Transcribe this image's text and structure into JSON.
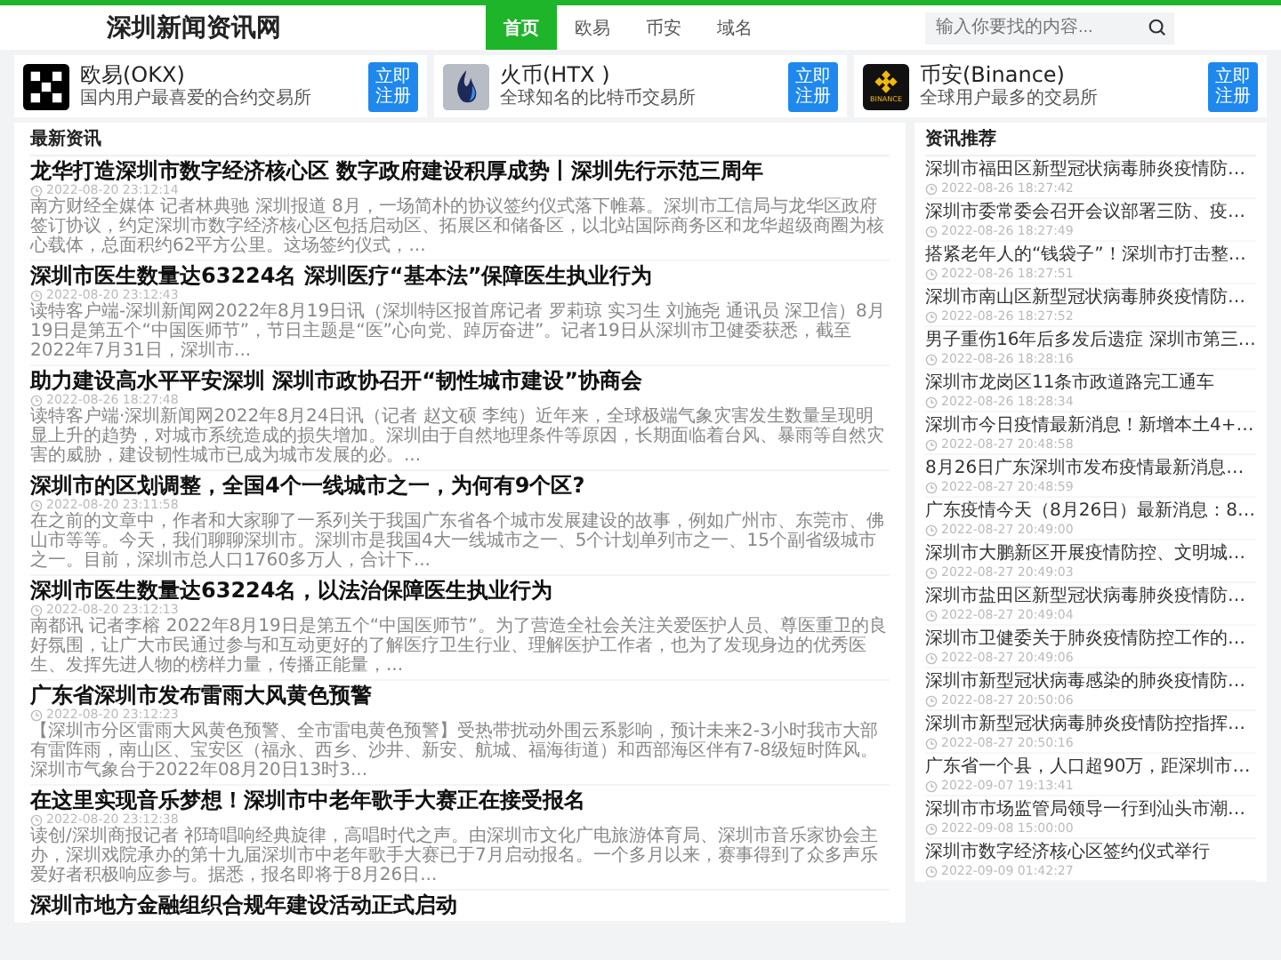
{
  "site": {
    "logo": "深圳新闻资讯网"
  },
  "nav": [
    {
      "label": "首页",
      "selected": true
    },
    {
      "label": "欧易",
      "selected": false
    },
    {
      "label": "币安",
      "selected": false
    },
    {
      "label": "域名",
      "selected": false
    }
  ],
  "search": {
    "placeholder": "输入你要找的内容..."
  },
  "exchanges": [
    {
      "kind": "okx",
      "name": "欧易(OKX)",
      "desc": "国内用户最喜爱的合约交易所",
      "button": "立即注册"
    },
    {
      "kind": "htx",
      "name": "火币(HTX )",
      "desc": "全球知名的比特币交易所",
      "button": "立即注册"
    },
    {
      "kind": "binance",
      "name": "币安(Binance)",
      "desc": "全球用户最多的交易所",
      "button": "立即注册",
      "logo_text": "BINANCE"
    }
  ],
  "latest": {
    "title": "最新资讯",
    "articles": [
      {
        "title": "龙华打造深圳市数字经济核心区 数字政府建设积厚成势丨深圳先行示范三周年",
        "time": "2022-08-20 23:12:14",
        "summary": "南方财经全媒体 记者林典驰 深圳报道 8月，一场简朴的协议签约仪式落下帷幕。深圳市工信局与龙华区政府签订协议，约定深圳市数字经济核心区包括启动区、拓展区和储备区，以北站国际商务区和龙华超级商圈为核心载体，总面积约62平方公里。这场签约仪式，..."
      },
      {
        "title": "深圳市医生数量达63224名 深圳医疗“基本法”保障医生执业行为",
        "time": "2022-08-20 23:12:43",
        "summary": "读特客户端-深圳新闻网2022年8月19日讯（深圳特区报首席记者 罗莉琼 实习生 刘施尧 通讯员 深卫信）8月19日是第五个“中国医师节”，节日主题是“医”心向党、踔厉奋进”。记者19日从深圳市卫健委获悉，截至2022年7月31日，深圳市..."
      },
      {
        "title": "助力建设高水平平安深圳 深圳市政协召开“韧性城市建设”协商会",
        "time": "2022-08-26 18:27:48",
        "summary": "读特客户端·深圳新闻网2022年8月24日讯（记者 赵文硕 李纯）近年来，全球极端气象灾害发生数量呈现明显上升的趋势，对城市系统造成的损失增加。深圳由于自然地理条件等原因，长期面临着台风、暴雨等自然灾害的威胁，建设韧性城市已成为城市发展的必。..."
      },
      {
        "title": "深圳市的区划调整，全国4个一线城市之一，为何有9个区?",
        "time": "2022-08-20 23:11:58",
        "summary": "在之前的文章中，作者和大家聊了一系列关于我国广东省各个城市发展建设的故事，例如广州市、东莞市、佛山市等等。今天，我们聊聊深圳市。深圳市是我国4大一线城市之一、5个计划单列市之一、15个副省级城市之一。目前，深圳市总人口1760多万人，合计下..."
      },
      {
        "title": "深圳市医生数量达63224名，以法治保障医生执业行为",
        "time": "2022-08-20 23:12:13",
        "summary": "南都讯 记者李榕 2022年8月19日是第五个“中国医师节”。为了营造全社会关注关爱医护人员、尊医重卫的良好氛围，让广大市民通过参与和互动更好的了解医疗卫生行业、理解医护工作者，也为了发现身边的优秀医生、发挥先进人物的榜样力量，传播正能量，..."
      },
      {
        "title": "广东省深圳市发布雷雨大风黄色预警",
        "time": "2022-08-20 23:12:23",
        "summary": "【深圳市分区雷雨大风黄色预警、全市雷电黄色预警】受热带扰动外围云系影响，预计未来2-3小时我市大部有雷阵雨，南山区、宝安区（福永、西乡、沙井、新安、航城、福海街道）和西部海区伴有7-8级短时阵风。深圳市气象台于2022年08月20日13时3..."
      },
      {
        "title": "在这里实现音乐梦想！深圳市中老年歌手大赛正在接受报名",
        "time": "2022-08-20 23:12:38",
        "summary": "读创/深圳商报记者 祁琦唱响经典旋律，高唱时代之声。由深圳市文化广电旅游体育局、深圳市音乐家协会主办，深圳戏院承办的第十九届深圳市中老年歌手大赛已于7月启动报名。一个多月以来，赛事得到了众多声乐爱好者积极响应参与。据悉，报名即将于8月26日..."
      },
      {
        "title": "深圳市地方金融组织合规年建设活动正式启动"
      }
    ]
  },
  "recommend": {
    "title": "资讯推荐",
    "items": [
      {
        "title": "深圳市福田区新型冠状病毒肺炎疫情防…",
        "time": "2022-08-26 18:27:42"
      },
      {
        "title": "深圳市委常委会召开会议部署三防、疫…",
        "time": "2022-08-26 18:27:49"
      },
      {
        "title": "搭紧老年人的“钱袋子”！深圳市打击整…",
        "time": "2022-08-26 18:27:51"
      },
      {
        "title": "深圳市南山区新型冠状病毒肺炎疫情防…",
        "time": "2022-08-26 18:27:52"
      },
      {
        "title": "男子重伤16年后多发后遗症 深圳市第三…",
        "time": "2022-08-26 18:28:16"
      },
      {
        "title": "深圳市龙岗区11条市政道路完工通车",
        "time": "2022-08-26 18:28:34"
      },
      {
        "title": "深圳市今日疫情最新消息！新增本土4+…",
        "time": "2022-08-27 20:48:58"
      },
      {
        "title": "8月26日广东深圳市发布疫情最新消息…",
        "time": "2022-08-27 20:48:59"
      },
      {
        "title": "广东疫情今天（8月26日）最新消息：8…",
        "time": "2022-08-27 20:49:00"
      },
      {
        "title": "深圳市大鹏新区开展疫情防控、文明城…",
        "time": "2022-08-27 20:49:03"
      },
      {
        "title": "深圳市盐田区新型冠状病毒肺炎疫情防…",
        "time": "2022-08-27 20:49:04"
      },
      {
        "title": "深圳市卫健委关于肺炎疫情防控工作的…",
        "time": "2022-08-27 20:49:06"
      },
      {
        "title": "深圳市新型冠状病毒感染的肺炎疫情防…",
        "time": "2022-08-27 20:50:06"
      },
      {
        "title": "深圳市新型冠状病毒肺炎疫情防控指挥…",
        "time": "2022-08-27 20:50:16"
      },
      {
        "title": "广东省一个县，人口超90万，距深圳市…",
        "time": "2022-09-07 19:13:41"
      },
      {
        "title": "深圳市市场监管局领导一行到汕头市潮…",
        "time": "2022-09-08 15:00:00"
      },
      {
        "title": "深圳市数字经济核心区签约仪式举行",
        "time": "2022-09-09 01:42:27"
      }
    ]
  }
}
